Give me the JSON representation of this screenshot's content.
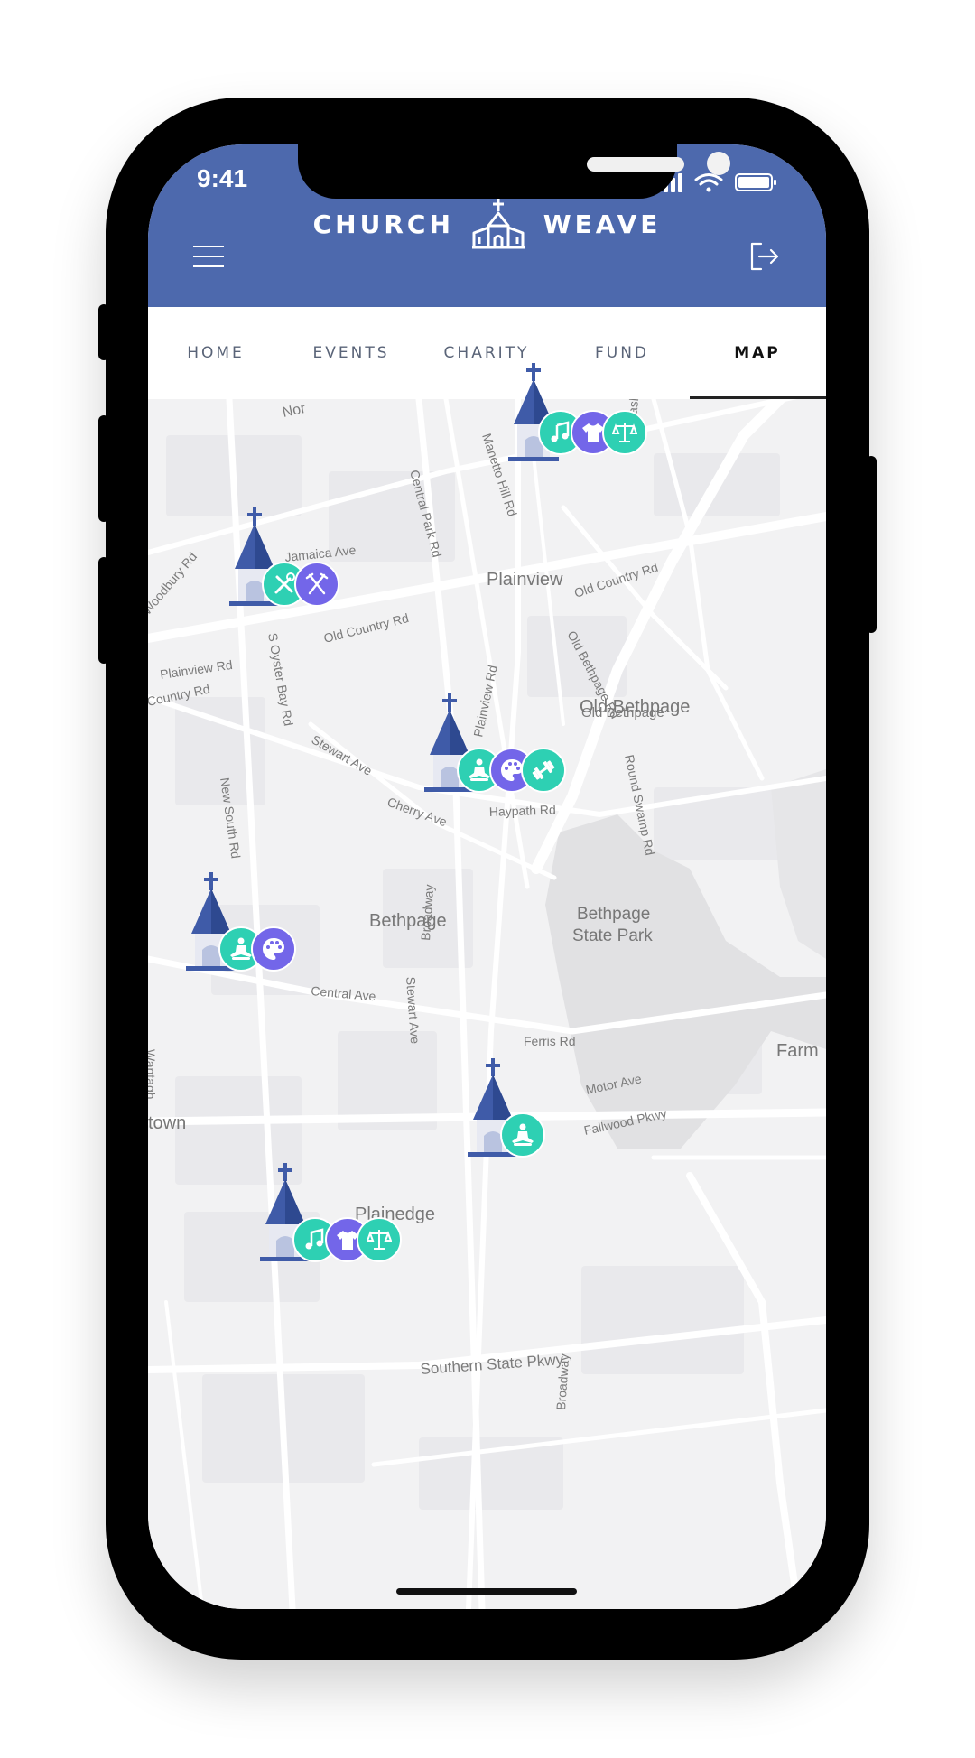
{
  "status_bar": {
    "time": "9:41"
  },
  "header": {
    "brand_left": "CHURCH",
    "brand_right": "WEAVE",
    "brand_color": "#4d69ad"
  },
  "tabs": [
    {
      "label": "HOME",
      "active": false
    },
    {
      "label": "EVENTS",
      "active": false
    },
    {
      "label": "CHARITY",
      "active": false
    },
    {
      "label": "FUND",
      "active": false
    },
    {
      "label": "MAP",
      "active": true
    }
  ],
  "map": {
    "places": [
      "Plainview",
      "Old Bethpage",
      "Bethpage",
      "Bethpage State Park",
      "Plainedge",
      "Farm",
      "town"
    ],
    "roads": [
      "Jamaica Ave",
      "Old Country Rd",
      "Plainview Rd",
      "S Oyster Bay Rd",
      "Central Park Rd",
      "Manetto Hill Rd",
      "Woodbury Rd",
      "Country Rd",
      "Old Bethpage Rd",
      "Plainview Rd",
      "Haypath Rd",
      "Round Swamp Rd",
      "Stewart Ave",
      "Cherry Ave",
      "New South Rd",
      "Broadway",
      "Central Ave",
      "Stewart Ave",
      "Motor Ave",
      "Fallwood Pkwy",
      "Southern State Pkwy",
      "Washi",
      "Ferris Rd",
      "Nor"
    ],
    "pins": [
      {
        "name": "church-north-east",
        "activities": [
          {
            "icon": "music-note-icon",
            "color": "teal"
          },
          {
            "icon": "tshirt-icon",
            "color": "purple"
          },
          {
            "icon": "scales-icon",
            "color": "teal"
          }
        ]
      },
      {
        "name": "church-west",
        "activities": [
          {
            "icon": "tools-icon",
            "color": "teal"
          },
          {
            "icon": "fork-knife-icon",
            "color": "purple"
          }
        ]
      },
      {
        "name": "church-center",
        "activities": [
          {
            "icon": "meditation-icon",
            "color": "teal"
          },
          {
            "icon": "palette-icon",
            "color": "purple"
          },
          {
            "icon": "dumbbell-icon",
            "color": "teal"
          }
        ]
      },
      {
        "name": "church-south-west",
        "activities": [
          {
            "icon": "meditation-icon",
            "color": "teal"
          },
          {
            "icon": "palette-icon",
            "color": "purple"
          }
        ]
      },
      {
        "name": "church-south-east",
        "activities": [
          {
            "icon": "meditation-icon",
            "color": "teal"
          }
        ]
      },
      {
        "name": "church-plainedge",
        "activities": [
          {
            "icon": "music-note-icon",
            "color": "teal"
          },
          {
            "icon": "tshirt-icon",
            "color": "purple"
          },
          {
            "icon": "scales-icon",
            "color": "teal"
          }
        ]
      }
    ],
    "colors": {
      "teal": "#2ed0b3",
      "purple": "#7366e9",
      "church_dark": "#3f5ba8",
      "church_light": "#b9c3e0"
    }
  }
}
